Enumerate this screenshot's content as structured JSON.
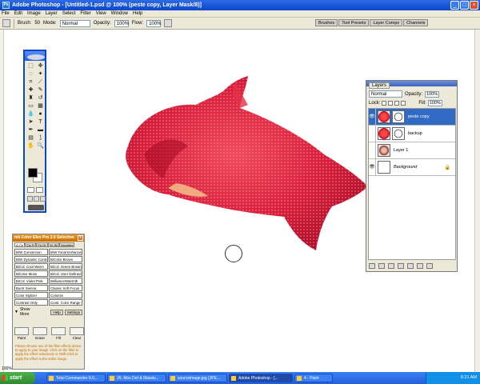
{
  "window": {
    "title": "Adobe Photoshop - [Untitled-1.psd @ 100% (peste copy, Layer Mask/8)]"
  },
  "menu": [
    "File",
    "Edit",
    "Image",
    "Layer",
    "Select",
    "Filter",
    "View",
    "Window",
    "Help"
  ],
  "options": {
    "brush_label": "Brush:",
    "brush_size": "50",
    "mode_label": "Mode:",
    "mode_value": "Normal",
    "opacity_label": "Opacity:",
    "opacity_value": "100%",
    "flow_label": "Flow:",
    "flow_value": "100%"
  },
  "palette_well": [
    "Brushes",
    "Tool Presets",
    "Layer Comps",
    "Channels"
  ],
  "layers_panel": {
    "tab": "Layers",
    "blend_mode": "Normal",
    "opacity_label": "Opacity:",
    "opacity_value": "100%",
    "lock_label": "Lock:",
    "fill_label": "Fill:",
    "fill_value": "100%",
    "layers": [
      {
        "name": "peste copy",
        "active": true,
        "visible": true
      },
      {
        "name": "backup",
        "active": false,
        "visible": false
      },
      {
        "name": "Layer 1",
        "active": false,
        "visible": false
      },
      {
        "name": "Background",
        "active": false,
        "visible": true
      }
    ]
  },
  "nik": {
    "title": "nik Color Efex Pro 2.0 Selective",
    "tabs": [
      "A-Ce",
      "Ca-Fr",
      "Fo-Gr",
      "Gr-Sk",
      "favorites"
    ],
    "filters": [
      "B/W Conversion",
      "B/W Tonal Enhancer",
      "B/W Dynamic Contrast",
      "BiColor Brown",
      "BiCol. Cool Warm",
      "BiCol. Green Brown",
      "BiColor Moss",
      "BiCol. User Defined",
      "BiCol. Violet Pink",
      "Brilliance/Warmth",
      "Burnt Sienna",
      "Classic Soft Focus",
      "Color Stylizer",
      "Colorize",
      "Contrast Only",
      "Contr. Color Range"
    ],
    "show_more": "Show More",
    "help": "Help",
    "settings": "Settings",
    "tools": [
      "Paint",
      "Erase",
      "Fill",
      "Clear"
    ],
    "help_text": "Please choose one of the filter effects above to apply to your image. Click on the filter to apply the effect selectively or Shift-Click to apply the effect to the entire image."
  },
  "status": {
    "zoom": "100%"
  },
  "taskbar": {
    "start": "start",
    "tasks": [
      "Total Commander 6.0...",
      "26. Mos Def & Massiv...",
      "sourceimage.jpg (JPE...",
      "Adobe Photoshop - [...",
      "4 - Paint"
    ],
    "clock": "6:21 AM"
  },
  "colors": {
    "fish_red": "#d8203c",
    "xp_blue": "#245edb",
    "panel_bg": "#ece9d8",
    "active_layer": "#316ac5"
  }
}
